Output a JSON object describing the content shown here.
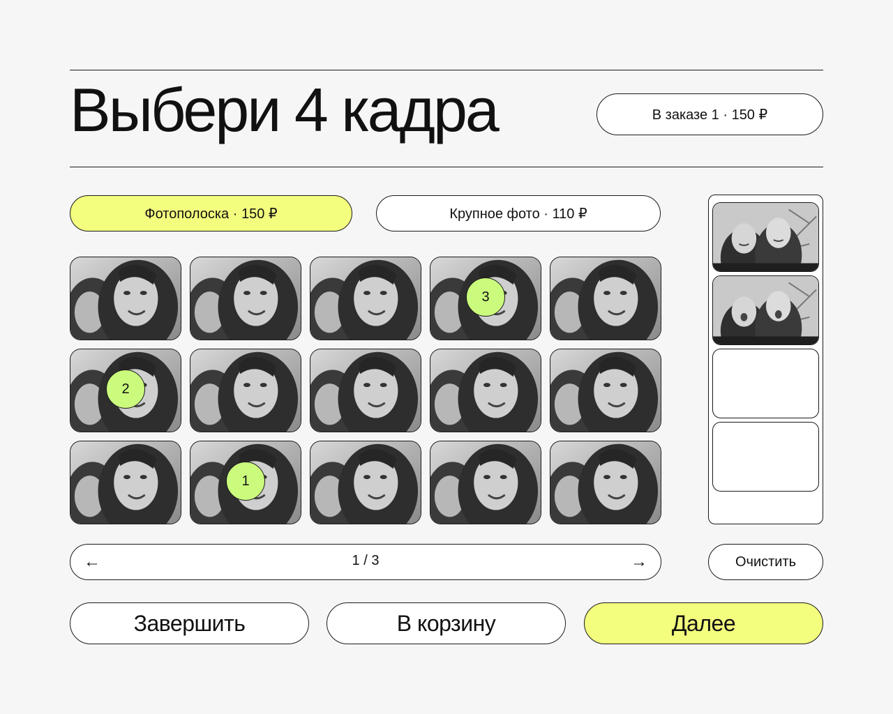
{
  "header": {
    "title": "Выбери 4 кадра",
    "order_badge": "В заказе 1 · 150 ₽"
  },
  "tabs": [
    {
      "label": "Фотополоска · 150 ₽",
      "active": true
    },
    {
      "label": "Крупное фото · 110 ₽",
      "active": false
    }
  ],
  "grid": {
    "rows": 3,
    "cols": 5,
    "selected": [
      {
        "row": 3,
        "col": 2,
        "order": "1"
      },
      {
        "row": 2,
        "col": 1,
        "order": "2"
      },
      {
        "row": 1,
        "col": 4,
        "order": "3"
      }
    ]
  },
  "strip_preview": {
    "slots": [
      "photo",
      "photo",
      "empty",
      "empty"
    ]
  },
  "pager": {
    "prev_icon": "arrow-left-icon",
    "next_icon": "arrow-right-icon",
    "page_label": "1 / 3"
  },
  "actions": {
    "clear_label": "Очистить",
    "finish_label": "Завершить",
    "cart_label": "В корзину",
    "next_label": "Далее"
  },
  "colors": {
    "accent": "#f3fe7e",
    "badge": "#cbfb7d",
    "background": "#f6f6f6",
    "outline": "#1a1a1a"
  }
}
